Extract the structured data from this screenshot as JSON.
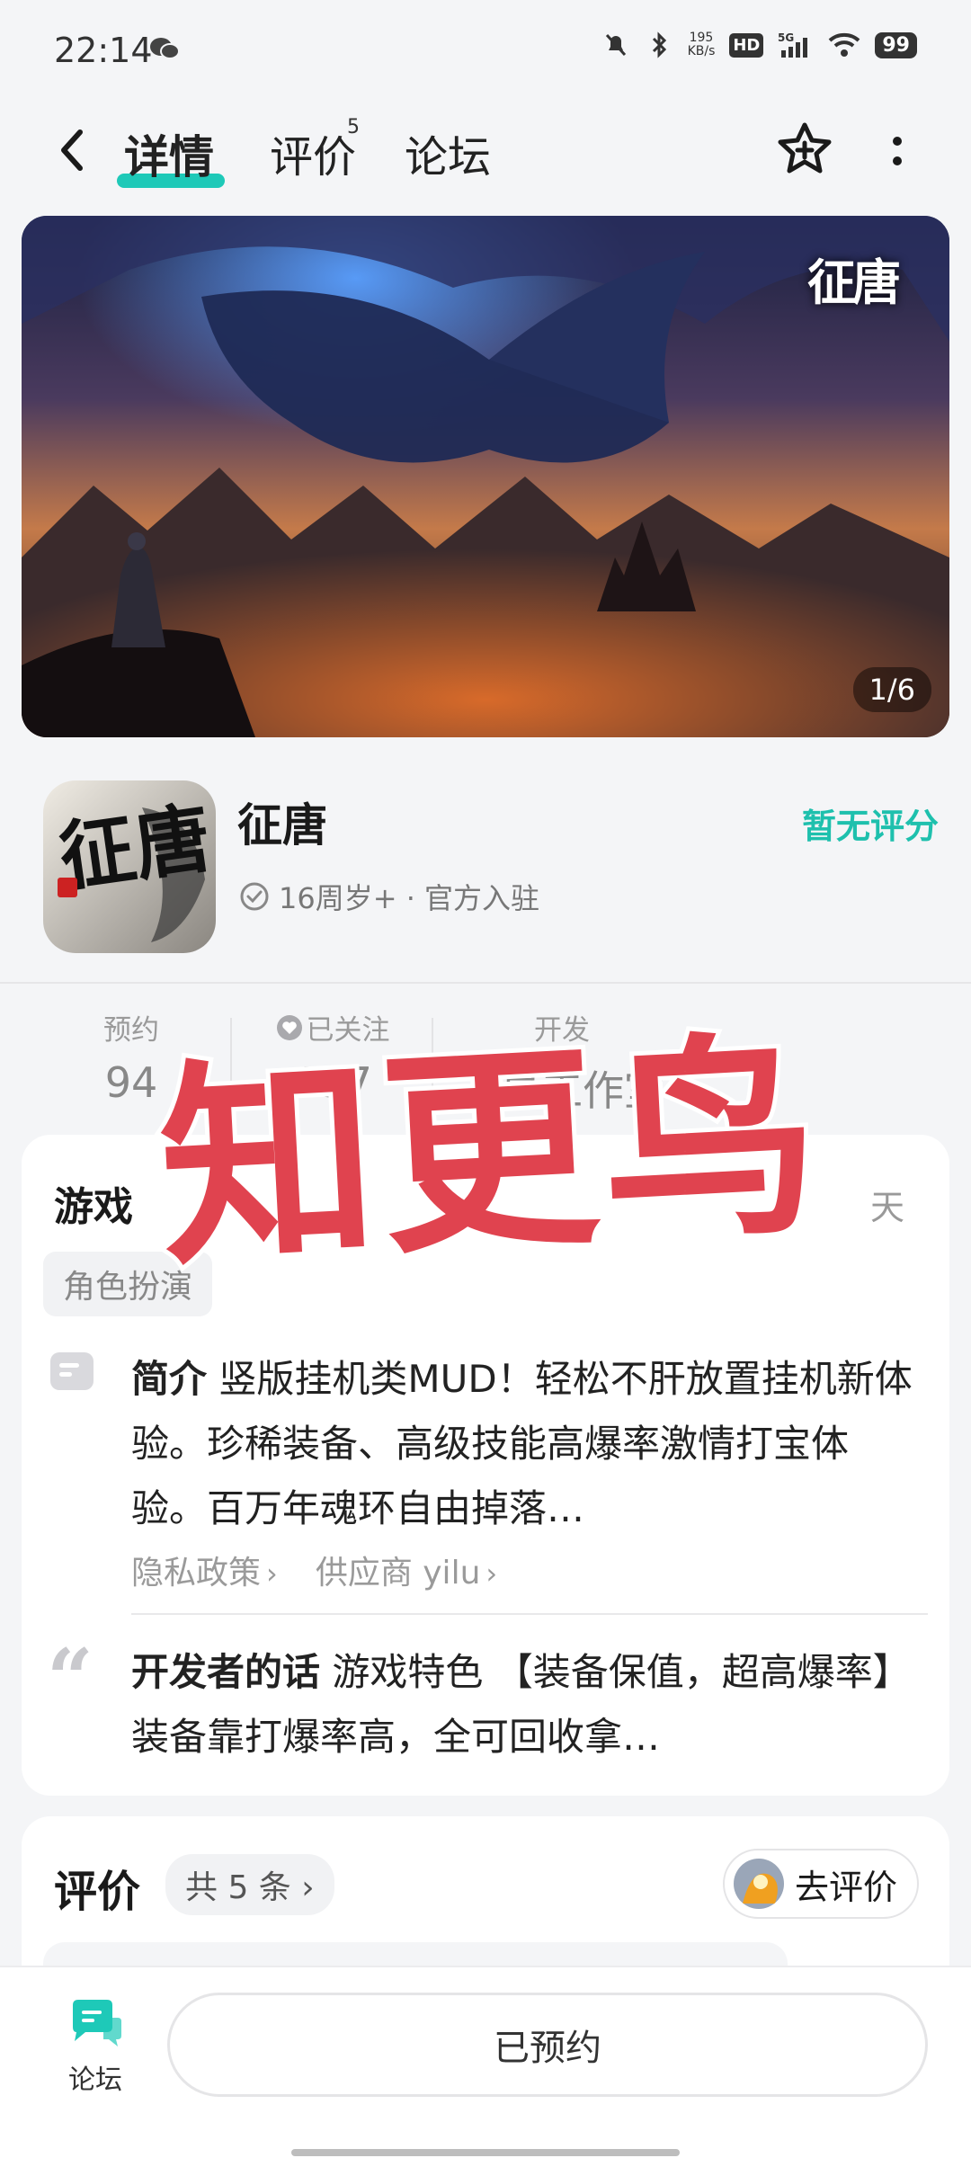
{
  "status_bar": {
    "time": "22:14",
    "net_speed_value": "195",
    "net_speed_unit": "KB/s",
    "hd": "HD",
    "network": "5G",
    "battery": "99",
    "icons": [
      "wechat-icon",
      "mute-bell-icon",
      "bluetooth-icon",
      "signal-icon",
      "wifi-icon",
      "battery-icon"
    ]
  },
  "nav": {
    "tabs": [
      {
        "label": "详情",
        "active": true
      },
      {
        "label": "评价",
        "badge": "5"
      },
      {
        "label": "论坛"
      }
    ],
    "icons": [
      "back-icon",
      "star-plus-icon",
      "more-icon"
    ]
  },
  "banner": {
    "counter": "1/6",
    "logo_text": "征唐"
  },
  "app": {
    "name": "征唐",
    "meta": "16周岁+ · 官方入驻",
    "rating": "暂无评分",
    "icon_text": "征唐",
    "accent_color": "#1ec0ad"
  },
  "stats": [
    {
      "label": "预约",
      "value": "94"
    },
    {
      "label": "已关注",
      "value": "157",
      "icon": "heart-icon"
    },
    {
      "label": "开发",
      "value": "五星工作室"
    }
  ],
  "info_card": {
    "section_title": "游戏",
    "section_tail": "天",
    "tag": "角色扮演",
    "intro_label": "简介",
    "intro_body": "竖版挂机类MUD！轻松不肝放置挂机新体验。珍稀装备、高级技能高爆率激情打宝体验。百万年魂环自由掉落…",
    "links": [
      "隐私政策",
      "供应商 yilu"
    ],
    "dev_label": "开发者的话",
    "dev_body": "游戏特色 【装备保值，超高爆率】 装备靠打爆率高，全可回收拿…"
  },
  "reviews": {
    "title": "评价",
    "count_label": "共 5 条",
    "go_review": "去评价"
  },
  "watermark": "知更鸟",
  "bottom_bar": {
    "forum_label": "论坛",
    "reserve_button": "已预约"
  }
}
